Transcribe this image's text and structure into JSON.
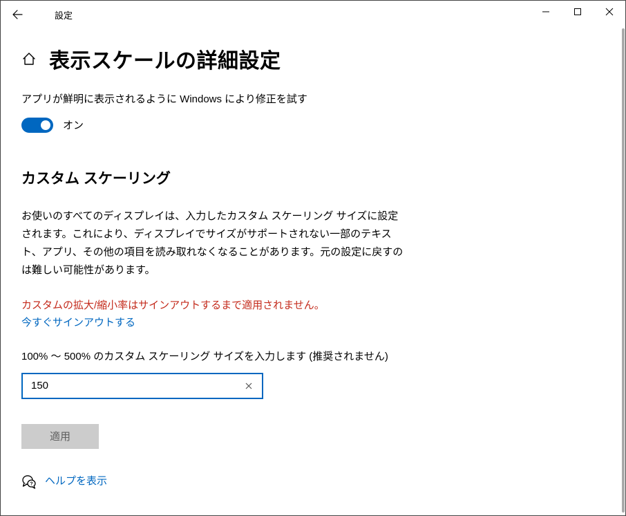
{
  "titlebar": {
    "title": "設定"
  },
  "heading": "表示スケールの詳細設定",
  "fix_apps": {
    "label": "アプリが鮮明に表示されるように Windows により修正を試す",
    "toggle_state": "オン"
  },
  "custom_scaling": {
    "heading": "カスタム スケーリング",
    "description": "お使いのすべてのディスプレイは、入力したカスタム スケーリング サイズに設定されます。これにより、ディスプレイでサイズがサポートされない一部のテキスト、アプリ、その他の項目を読み取れなくなることがあります。元の設定に戻すのは難しい可能性があります。",
    "warning": "カスタムの拡大/縮小率はサインアウトするまで適用されません。",
    "signout_link": "今すぐサインアウトする",
    "input_label": "100% ～ 500% のカスタム スケーリング サイズを入力します (推奨されません)",
    "input_value": "150",
    "apply_button": "適用"
  },
  "help_link": "ヘルプを表示"
}
